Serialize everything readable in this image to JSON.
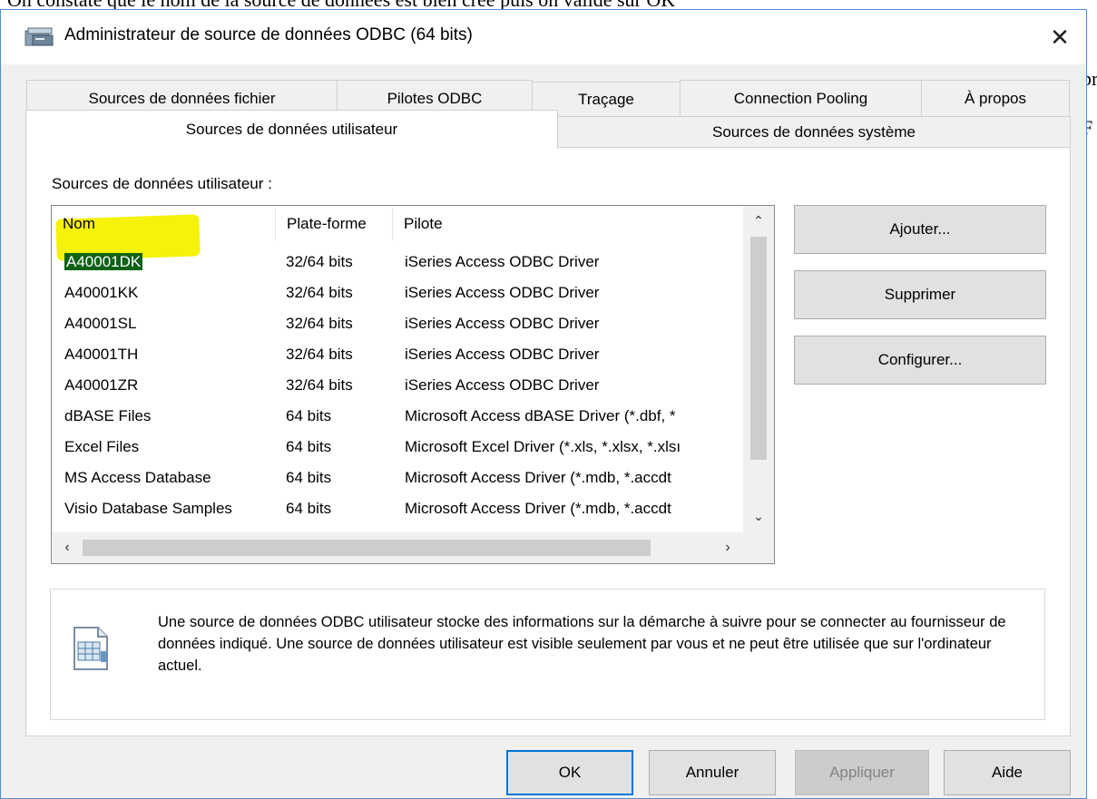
{
  "document": {
    "caption_text": "On constate que le nom de la source de données est bien créé puis on valide sur OK",
    "right_edge_fragments": [
      "pr",
      "F"
    ]
  },
  "window": {
    "title": "Administrateur de source de données ODBC (64 bits)",
    "close_glyph": "✕"
  },
  "tabs": {
    "back_row": [
      "Sources de données fichier",
      "Pilotes ODBC",
      "Traçage",
      "Connection Pooling",
      "À propos"
    ],
    "front_row": [
      "Sources de données utilisateur",
      "Sources de données système"
    ],
    "active": "Sources de données utilisateur"
  },
  "panel": {
    "section_label": "Sources de données utilisateur :",
    "columns": [
      "Nom",
      "Plate-forme",
      "Pilote"
    ],
    "rows": [
      {
        "nom": "A40001DK",
        "plateforme": "32/64 bits",
        "pilote": "iSeries Access ODBC Driver",
        "selected": true
      },
      {
        "nom": "A40001KK",
        "plateforme": "32/64 bits",
        "pilote": "iSeries Access ODBC Driver"
      },
      {
        "nom": "A40001SL",
        "plateforme": "32/64 bits",
        "pilote": "iSeries Access ODBC Driver"
      },
      {
        "nom": "A40001TH",
        "plateforme": "32/64 bits",
        "pilote": "iSeries Access ODBC Driver"
      },
      {
        "nom": "A40001ZR",
        "plateforme": "32/64 bits",
        "pilote": "iSeries Access ODBC Driver"
      },
      {
        "nom": "dBASE Files",
        "plateforme": "64 bits",
        "pilote": "Microsoft Access dBASE Driver (*.dbf, *"
      },
      {
        "nom": "Excel Files",
        "plateforme": "64 bits",
        "pilote": "Microsoft Excel Driver (*.xls, *.xlsx, *.xlsı"
      },
      {
        "nom": "MS Access Database",
        "plateforme": "64 bits",
        "pilote": "Microsoft Access Driver (*.mdb, *.accdt"
      },
      {
        "nom": "Visio Database Samples",
        "plateforme": "64 bits",
        "pilote": "Microsoft Access Driver (*.mdb, *.accdt"
      }
    ],
    "side_buttons": [
      "Ajouter...",
      "Supprimer",
      "Configurer..."
    ],
    "info_text": "Une source de données ODBC utilisateur stocke des informations sur la démarche à suivre pour se connecter au fournisseur de données indiqué.   Une source de données utilisateur est visible seulement par vous et ne peut être utilisée que sur l'ordinateur actuel."
  },
  "footer_buttons": {
    "ok": "OK",
    "cancel": "Annuler",
    "apply": "Appliquer",
    "help": "Aide"
  },
  "colors": {
    "accent": "#0078d7",
    "highlight_marker": "#f6f20a",
    "selection": "#0e6216"
  },
  "icons": {
    "title": "odbc-admin-icon",
    "close": "close-icon",
    "info": "data-source-icon"
  }
}
